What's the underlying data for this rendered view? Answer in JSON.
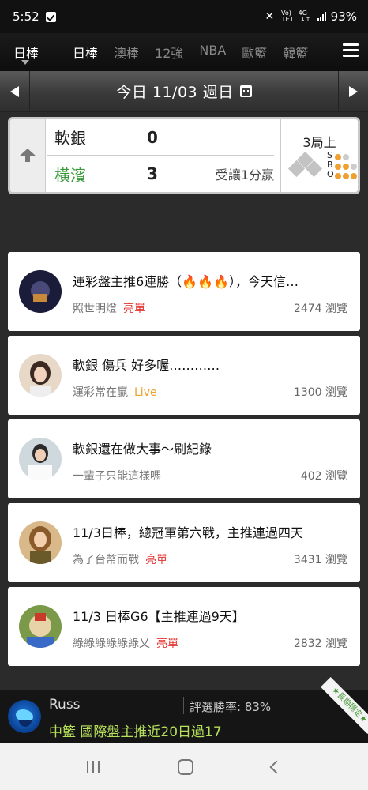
{
  "status_bar": {
    "time": "5:52",
    "network_top": "Vo)",
    "network_bottom": "LTE1",
    "data_type": "4G+",
    "battery": "93%"
  },
  "tabs": {
    "current": "日棒",
    "items": [
      "日棒",
      "澳棒",
      "12強",
      "NBA",
      "歐籃",
      "韓籃"
    ]
  },
  "date_bar": {
    "label": "今日 11/03 週日"
  },
  "game": {
    "away_team": "軟銀",
    "away_score": "0",
    "home_team": "橫濱",
    "home_score": "3",
    "note": "受讓1分贏",
    "inning": "3局上",
    "sbo_labels": [
      "S",
      "B",
      "O"
    ],
    "colors": {
      "home_team": "#3a9a3a",
      "count_on": "#f0a030"
    }
  },
  "posts": [
    {
      "title": "運彩盤主推6連勝（🔥🔥🔥），今天信…",
      "author": "照世明燈",
      "tag": "亮單",
      "tag_style": "red",
      "views": "2474 瀏覽"
    },
    {
      "title": "軟銀 傷兵 好多喔…………",
      "author": "運彩常在贏",
      "tag": "Live",
      "tag_style": "orange",
      "views": "1300 瀏覽"
    },
    {
      "title": "軟銀還在做大事～刷紀錄",
      "author": "一輩子只能這樣嗎",
      "tag": "",
      "tag_style": "",
      "views": "402 瀏覽"
    },
    {
      "title": "11/3日棒，總冠軍第六戰，主推連過四天",
      "author": "為了台幣而戰",
      "tag": "亮單",
      "tag_style": "red",
      "views": "3431 瀏覽"
    },
    {
      "title": "11/3 日棒G6【主推連過9天】",
      "author": "綠綠綠綠綠綠乂",
      "tag": "亮單",
      "tag_style": "red",
      "views": "2832 瀏覽"
    }
  ],
  "promo": {
    "name": "Russ",
    "rate": "評選勝率: 83%",
    "headline": "中籃 國際盤主推近20日過17",
    "ribbon": "★長期穩定★"
  }
}
